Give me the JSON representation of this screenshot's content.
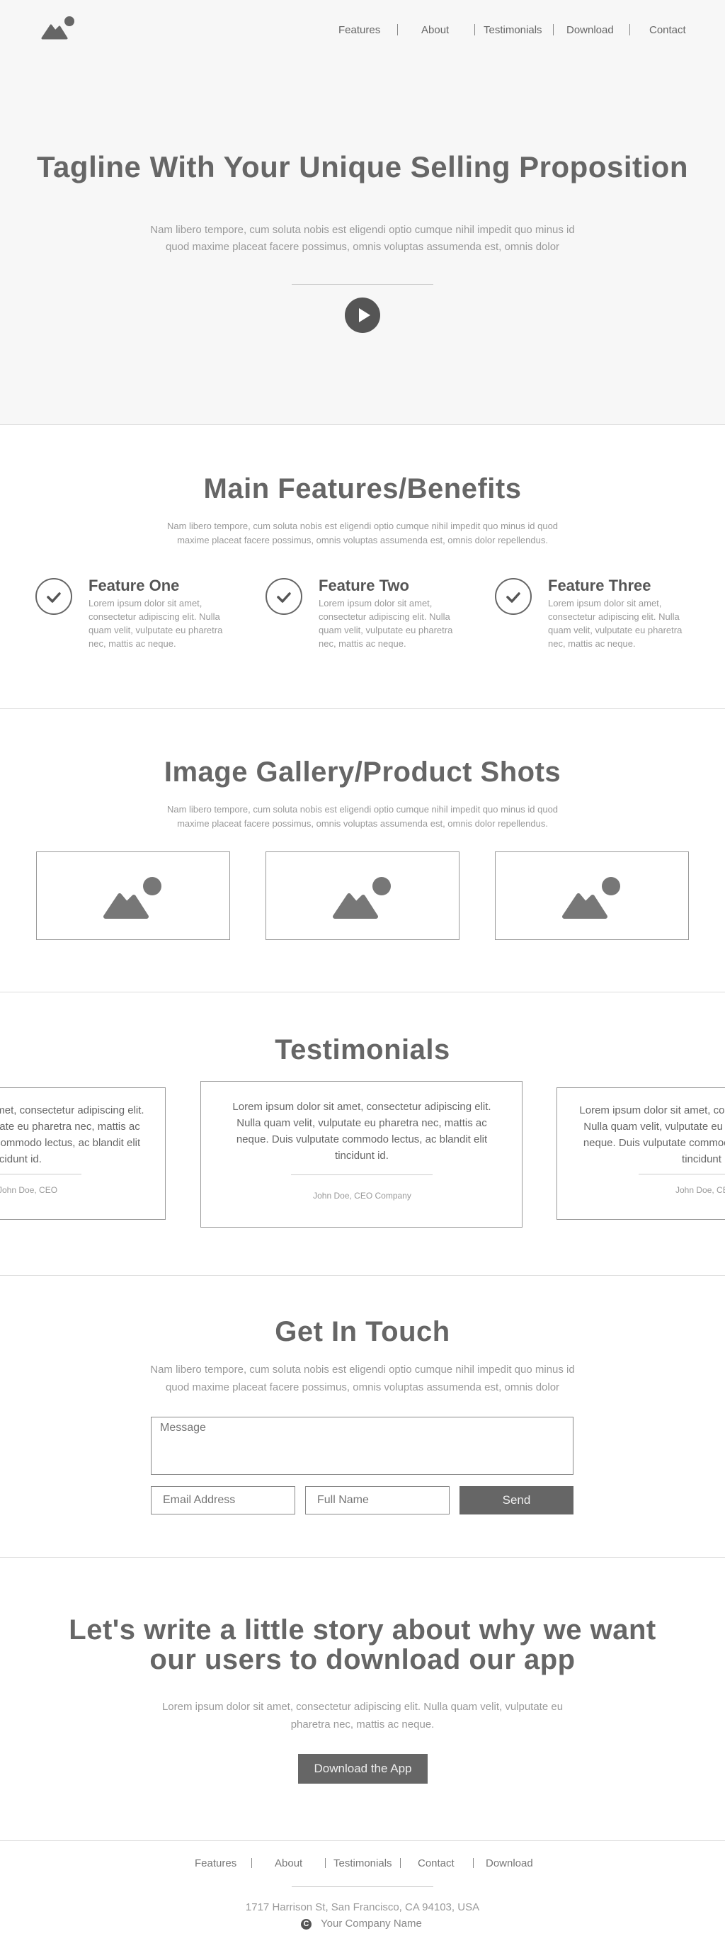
{
  "header": {
    "logo_icon": "image-icon",
    "nav": [
      "Features",
      "About",
      "Testimonials",
      "Download",
      "Contact"
    ]
  },
  "hero": {
    "title": "Tagline With Your Unique Selling Proposition",
    "subtitle": "Nam libero tempore, cum soluta nobis est eligendi optio cumque nihil impedit quo minus id quod maxime placeat facere possimus, omnis voluptas assumenda est, omnis dolor",
    "play_icon": "play-icon"
  },
  "features": {
    "title": "Main Features/Benefits",
    "subtitle": "Nam libero tempore, cum soluta nobis est eligendi optio cumque nihil impedit quo minus id quod maxime placeat facere possimus, omnis voluptas assumenda est, omnis dolor repellendus.",
    "items": [
      {
        "title": "Feature One",
        "text": "Lorem ipsum dolor sit amet, consectetur adipiscing elit. Nulla quam velit, vulputate eu pharetra nec, mattis ac neque."
      },
      {
        "title": "Feature Two",
        "text": "Lorem ipsum dolor sit amet, consectetur adipiscing elit. Nulla quam velit, vulputate eu pharetra nec, mattis ac neque."
      },
      {
        "title": "Feature Three",
        "text": "Lorem ipsum dolor sit amet, consectetur adipiscing elit. Nulla quam velit, vulputate eu pharetra nec, mattis ac neque."
      }
    ]
  },
  "gallery": {
    "title": "Image Gallery/Product Shots",
    "subtitle": "Nam libero tempore, cum soluta nobis est eligendi optio cumque nihil impedit quo minus id quod maxime placeat facere possimus, omnis voluptas assumenda est, omnis dolor repellendus."
  },
  "testimonials": {
    "title": "Testimonials",
    "items": [
      {
        "text": "Lorem ipsum dolor sit amet, consectetur adipiscing elit. Nulla quam velit, vulputate eu pharetra nec, mattis ac neque. Duis vulputate commodo lectus, ac blandit elit tincidunt id.",
        "author": "John Doe, CEO"
      },
      {
        "text": "Lorem ipsum dolor sit amet, consectetur adipiscing elit. Nulla quam velit, vulputate eu pharetra nec, mattis ac neque. Duis vulputate commodo lectus, ac blandit elit tincidunt id.",
        "author": "John Doe, CEO Company"
      },
      {
        "text": "Lorem ipsum dolor sit amet, consectetur adipiscing elit. Nulla quam velit, vulputate eu pharetra nec, mattis ac neque. Duis vulputate commodo lectus, ac blandit elit tincidunt id.",
        "author": "John Doe, CEO"
      }
    ]
  },
  "contact": {
    "title": "Get In Touch",
    "subtitle": "Nam libero tempore, cum soluta nobis est eligendi optio cumque nihil impedit quo minus id quod maxime placeat facere possimus, omnis voluptas assumenda est, omnis dolor",
    "message_placeholder": "Message",
    "email_placeholder": "Email Address",
    "name_placeholder": "Full Name",
    "send_label": "Send"
  },
  "cta": {
    "title": "Let's write a little story about why we want our users to download our app",
    "subtitle": "Lorem ipsum dolor sit amet, consectetur adipiscing elit. Nulla quam velit, vulputate eu pharetra nec, mattis ac neque.",
    "button_label": "Download the App"
  },
  "footer": {
    "nav": [
      "Features",
      "About",
      "Testimonials",
      "Contact",
      "Download"
    ],
    "address": "1717 Harrison St, San Francisco, CA 94103, USA",
    "copyright_icon": "copyright-icon",
    "company": "Your Company Name"
  },
  "colors": {
    "background": "#ffffff",
    "hero_background": "#f7f7f7",
    "text": "#666666",
    "muted_text": "#999999",
    "button": "#666666",
    "border": "#999999"
  }
}
